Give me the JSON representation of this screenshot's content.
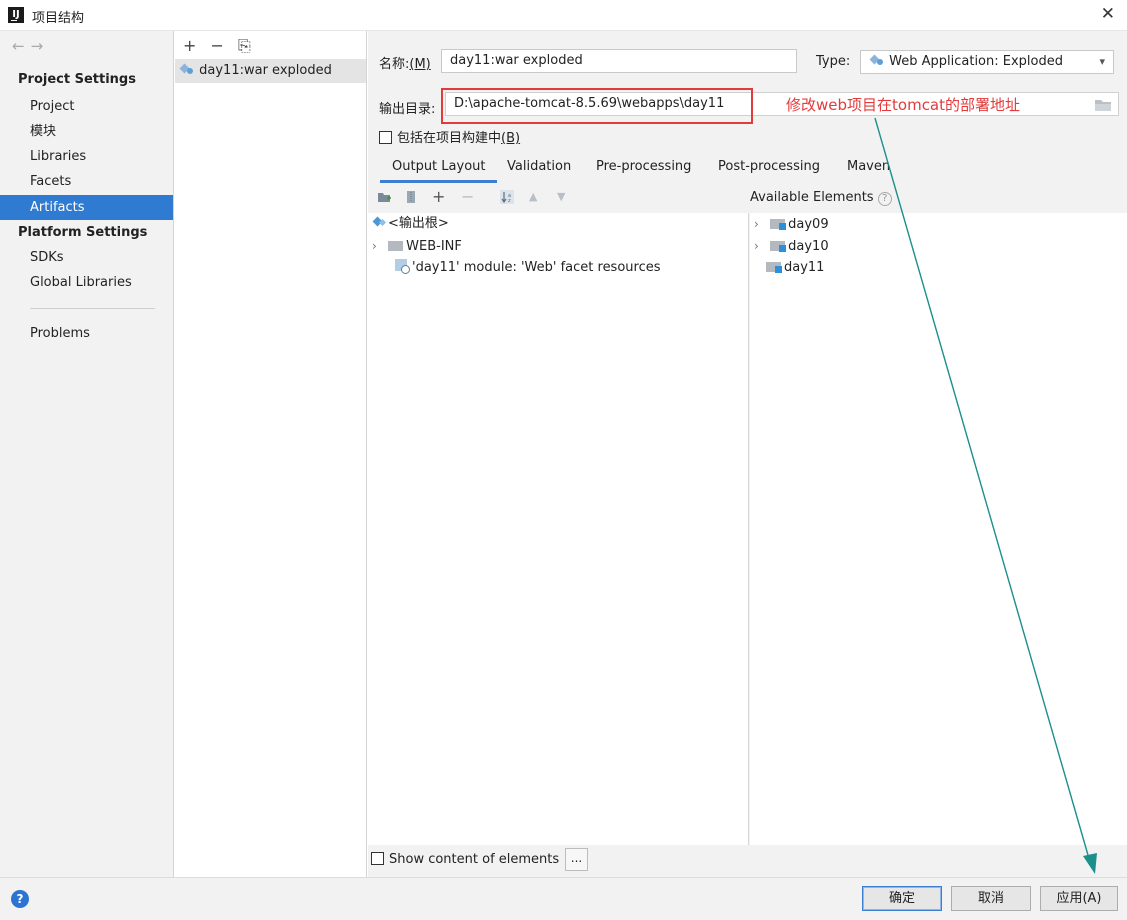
{
  "window": {
    "title": "项目结构",
    "app_icon": "IJ"
  },
  "left_nav": {
    "project_settings_header": "Project Settings",
    "platform_settings_header": "Platform Settings",
    "items": [
      "Project",
      "模块",
      "Libraries",
      "Facets",
      "Artifacts"
    ],
    "platform_items": [
      "SDKs",
      "Global Libraries"
    ],
    "problems": "Problems",
    "selected": "Artifacts"
  },
  "artifacts": {
    "toolbar": [
      "+",
      "−",
      "⎘"
    ],
    "items": [
      "day11:war exploded"
    ]
  },
  "detail": {
    "name_label": "名称:",
    "name_mnemonic": "(M)",
    "name_value": "day11:war exploded",
    "type_label": "Type:",
    "type_value": "Web Application: Exploded",
    "output_label": "输出目录:",
    "output_value": "D:\\apache-tomcat-8.5.69\\webapps\\day11",
    "annotation": "修改web项目在tomcat的部署地址",
    "include_label": "包括在项目构建中",
    "include_mnemonic": "(B)",
    "tabs": [
      "Output Layout",
      "Validation",
      "Pre-processing",
      "Post-processing",
      "Maven"
    ],
    "active_tab": "Output Layout",
    "output_tree": [
      {
        "label": "<输出根>",
        "icon": "output-root-icon"
      },
      {
        "label": "WEB-INF",
        "icon": "folder-icon",
        "expandable": true
      },
      {
        "label": "'day11' module: 'Web' facet resources",
        "icon": "web-resource-icon"
      }
    ],
    "available_header": "Available Elements",
    "available_tree": [
      {
        "label": "day09",
        "expandable": true
      },
      {
        "label": "day10",
        "expandable": true
      },
      {
        "label": "day11",
        "expandable": false
      }
    ],
    "show_content_label": "Show content of elements",
    "dots_label": "..."
  },
  "footer": {
    "ok": "确定",
    "cancel": "取消",
    "apply": "应用(A)",
    "help": "?"
  },
  "colors": {
    "accent": "#2f7bd1",
    "annotation": "#e23b3b",
    "arrow": "#1a8f8c"
  }
}
